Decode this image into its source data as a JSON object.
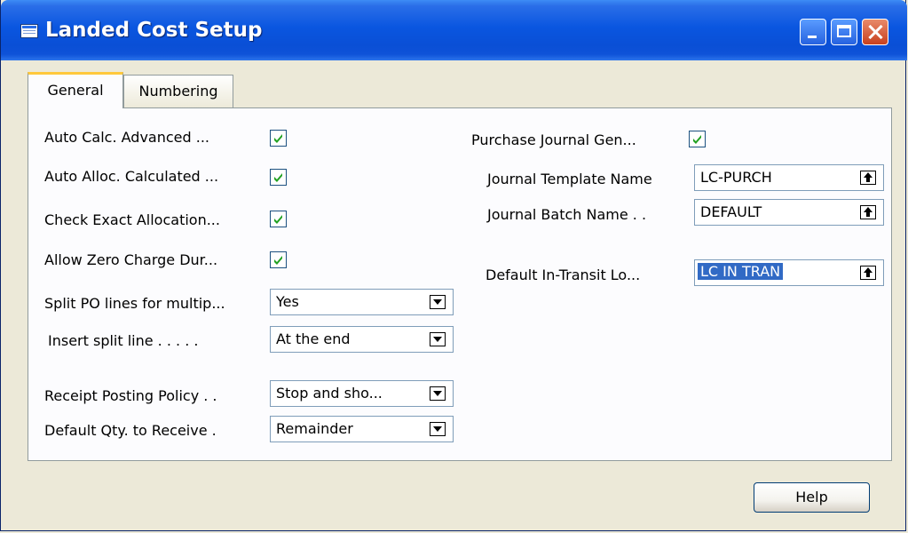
{
  "window": {
    "title": "Landed Cost Setup"
  },
  "tabs": [
    {
      "label": "General",
      "active": true
    },
    {
      "label": "Numbering",
      "active": false
    }
  ],
  "left": {
    "auto_calc_label": "Auto Calc. Advanced ...",
    "auto_calc_checked": true,
    "auto_alloc_label": "Auto Alloc. Calculated ...",
    "auto_alloc_checked": true,
    "check_exact_label": "Check Exact Allocation...",
    "check_exact_checked": true,
    "allow_zero_label": "Allow Zero Charge Dur...",
    "allow_zero_checked": true,
    "split_po_label": "Split PO lines for multip...",
    "split_po_value": "Yes",
    "insert_split_label": "Insert split line . . . . .",
    "insert_split_value": "At the end",
    "receipt_policy_label": "Receipt Posting Policy . .",
    "receipt_policy_value": "Stop and sho...",
    "default_qty_label": "Default Qty. to Receive .",
    "default_qty_value": "Remainder"
  },
  "right": {
    "purchase_journal_label": "Purchase Journal Gen...",
    "purchase_journal_checked": true,
    "journal_template_label": "Journal Template Name",
    "journal_template_value": "LC-PURCH",
    "journal_batch_label": "Journal Batch Name . .",
    "journal_batch_value": "DEFAULT",
    "default_transit_label": "Default In-Transit Lo...",
    "default_transit_value": "LC IN TRAN"
  },
  "buttons": {
    "help_label": "Help"
  },
  "colors": {
    "titlebar": "#0a56e0",
    "check": "#21a121",
    "selection": "#316ac5",
    "tab_highlight": "#ffc83c"
  },
  "icons": {
    "window": "table-window-icon",
    "minimize": "minimize-icon",
    "maximize": "maximize-icon",
    "close": "close-icon",
    "dropdown": "dropdown-arrow-icon",
    "lookup": "lookup-arrow-icon",
    "checkmark": "checkmark-icon"
  }
}
